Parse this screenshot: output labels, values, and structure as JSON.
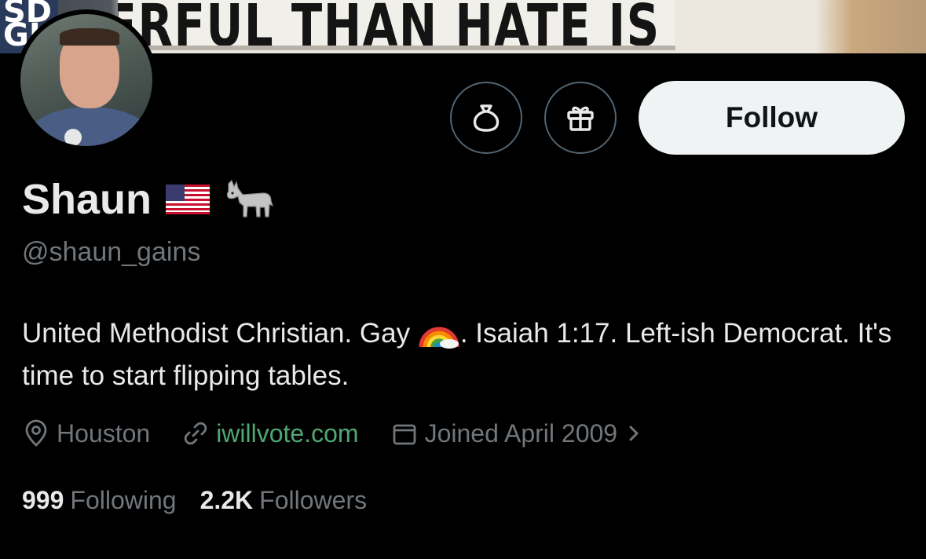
{
  "banner": {
    "sign_text": "POWERFUL THAN HATE IS LOVE",
    "left_text": "SD\nGH"
  },
  "profile": {
    "name": "Shaun",
    "handle": "@shaun_gains",
    "bio_part1": "United Methodist Christian. Gay ",
    "bio_part2": ". Isaiah 1:17. Left-ish Democrat. It's time to start flipping tables.",
    "location": "Houston",
    "website": "iwillvote.com",
    "joined": "Joined April 2009",
    "following_count": "999",
    "following_label": "Following",
    "followers_count": "2.2K",
    "followers_label": "Followers"
  },
  "actions": {
    "follow_label": "Follow",
    "tip_icon": "money-bag-icon",
    "gift_icon": "gift-icon"
  },
  "colors": {
    "background": "#000000",
    "primary_text": "#e7e9ea",
    "secondary_text": "#71767b",
    "link": "#4fa872",
    "follow_button_bg": "#eff3f4"
  }
}
